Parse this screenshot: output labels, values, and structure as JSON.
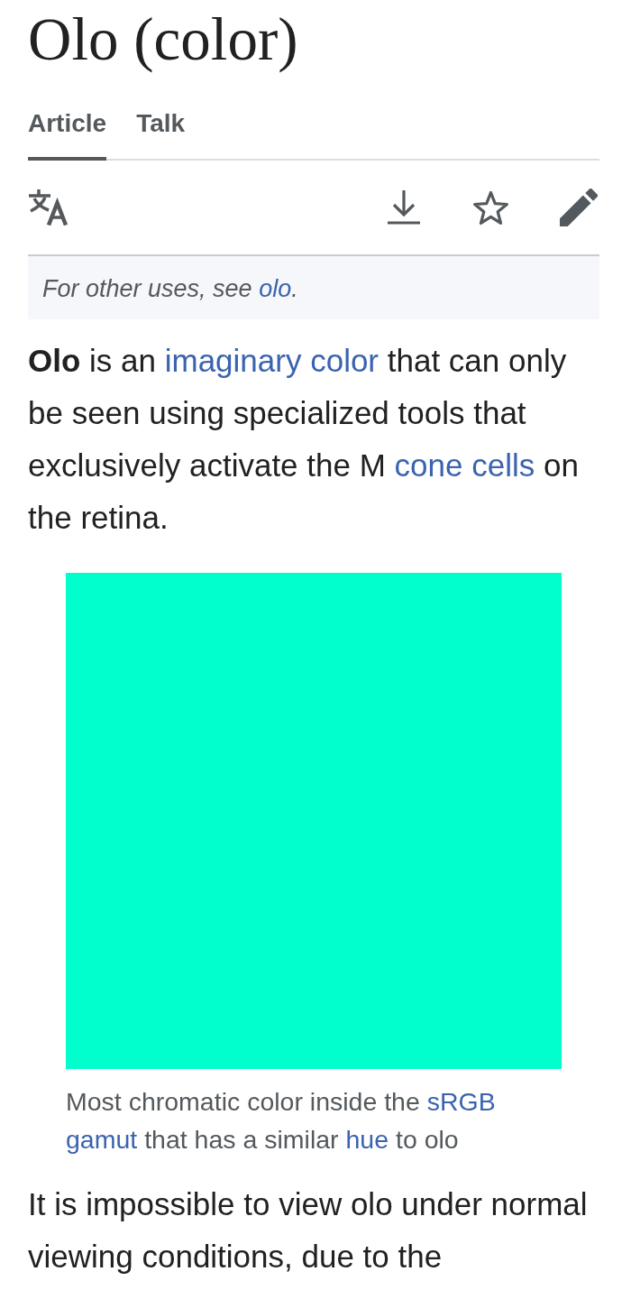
{
  "title": "Olo (color)",
  "tabs": [
    {
      "label": "Article",
      "selected": true
    },
    {
      "label": "Talk",
      "selected": false
    }
  ],
  "hatnote": [
    {
      "kind": "text",
      "text": "For other uses, see "
    },
    {
      "kind": "link",
      "text": "olo"
    },
    {
      "kind": "text",
      "text": "."
    }
  ],
  "content": [
    {
      "kind": "paragraph",
      "parts": [
        {
          "kind": "bold",
          "text": "Olo"
        },
        {
          "kind": "text",
          "text": " is an "
        },
        {
          "kind": "link",
          "text": "imaginary color"
        },
        {
          "kind": "text",
          "text": " that can only be seen using specialized tools that exclusively activate the M "
        },
        {
          "kind": "link",
          "text": "cone cells"
        },
        {
          "kind": "text",
          "text": " on the retina."
        }
      ]
    },
    {
      "kind": "figure",
      "color": "#00ffcc",
      "caption": [
        {
          "kind": "text",
          "text": "Most chromatic color inside the "
        },
        {
          "kind": "link",
          "text": "sRGB"
        },
        {
          "kind": "space"
        },
        {
          "kind": "link",
          "text": "gamut"
        },
        {
          "kind": "text",
          "text": " that has a similar "
        },
        {
          "kind": "link",
          "text": "hue"
        },
        {
          "kind": "text",
          "text": " to olo"
        }
      ]
    },
    {
      "kind": "paragraph",
      "parts": [
        {
          "kind": "text",
          "text": "It is impossible to view olo under normal viewing conditions, due to the"
        }
      ]
    }
  ]
}
